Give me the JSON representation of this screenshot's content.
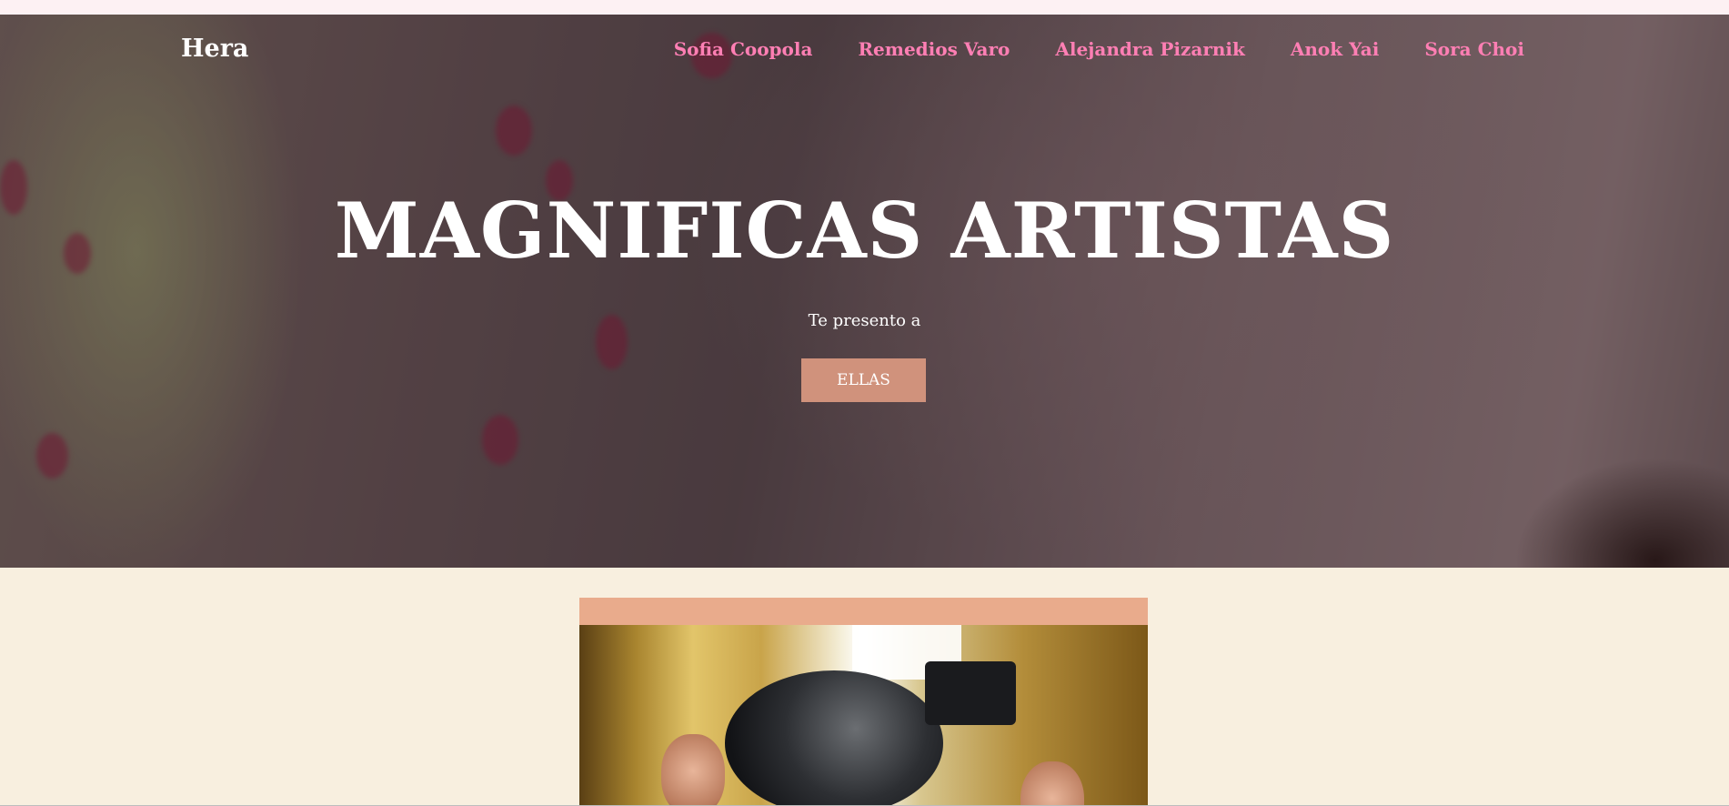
{
  "nav": {
    "brand": "Hera",
    "links": [
      {
        "label": "Sofia Coopola"
      },
      {
        "label": "Remedios Varo"
      },
      {
        "label": "Alejandra Pizarnik"
      },
      {
        "label": "Anok Yai"
      },
      {
        "label": "Sora Choi"
      }
    ]
  },
  "hero": {
    "title": "MAGNIFICAS ARTISTAS",
    "subtitle": "Te presento a",
    "button_label": "ELLAS"
  },
  "colors": {
    "nav_link": "#ff7fb4",
    "button_bg": "#d0927c",
    "section_bg": "#f8efdf",
    "card_header": "#e9ab8c"
  },
  "icons": {
    "hero_image": "pink-lily-flower-closeup",
    "card_image": "film-camera-crew-photo"
  }
}
